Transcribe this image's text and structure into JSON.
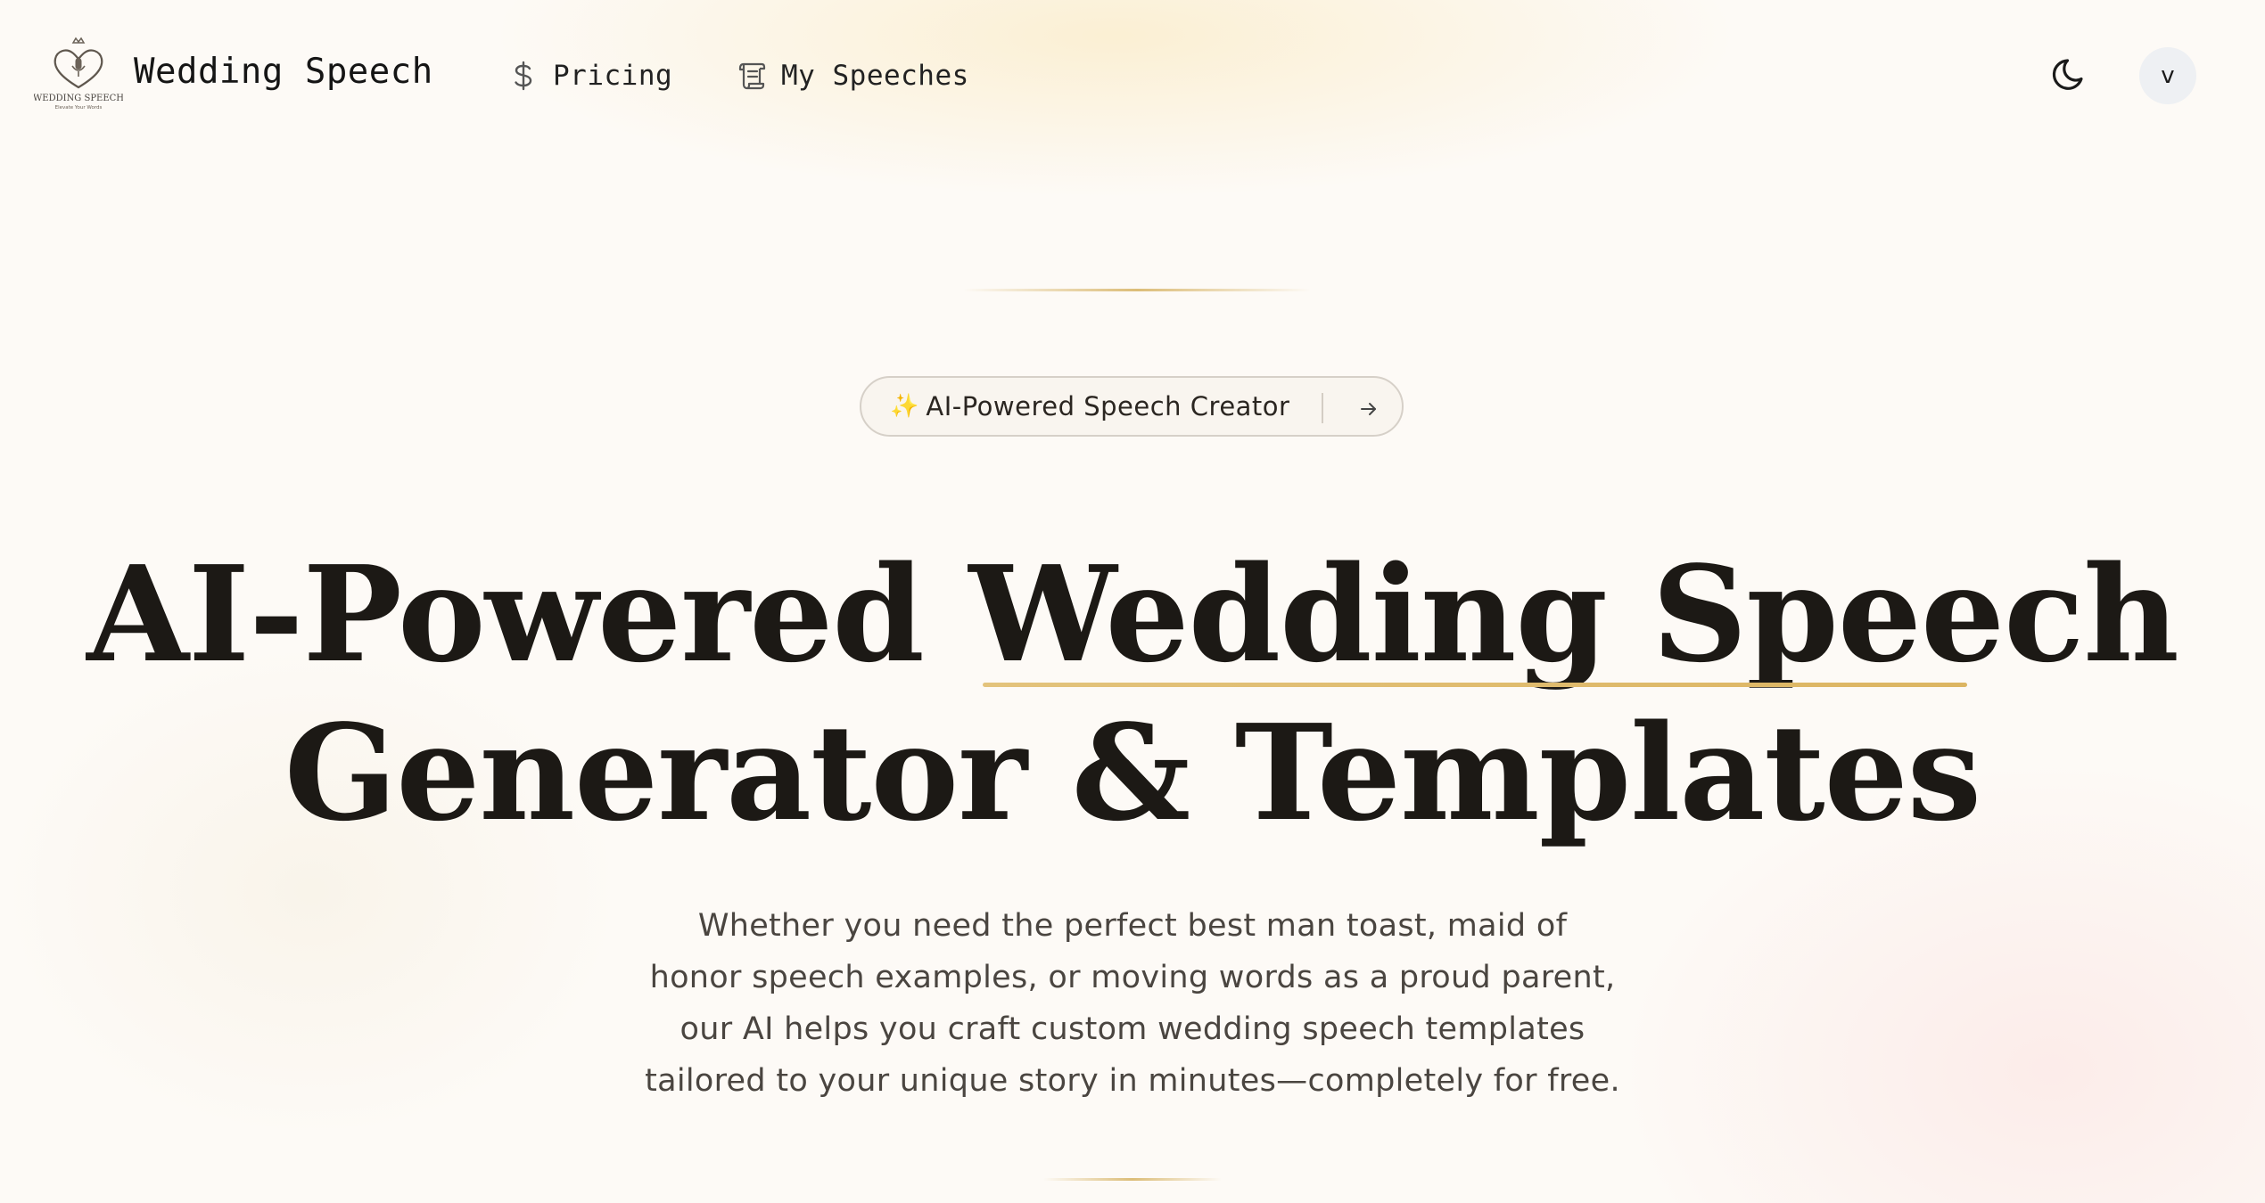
{
  "nav": {
    "brand": "Wedding Speech",
    "logo_text": "WEDDING SPEECH",
    "logo_tagline": "Elevate Your Words",
    "links": [
      {
        "label": "Pricing",
        "icon": "dollar-icon"
      },
      {
        "label": "My Speeches",
        "icon": "scroll-icon"
      }
    ],
    "theme_icon": "moon-icon",
    "avatar_initial": "v"
  },
  "badge": {
    "sparkle": "✨",
    "label": "AI-Powered Speech Creator",
    "icon": "arrow-right-icon"
  },
  "hero": {
    "title_line1": "AI-Powered Wedding Speech",
    "title_line2": "Generator & Templates",
    "subtitle_lines": [
      "Whether you need the perfect best man toast, maid of",
      "honor speech examples, or moving words as a proud parent,",
      "our AI helps you craft custom wedding speech templates",
      "tailored to your unique story in minutes—completely for free."
    ]
  },
  "colors": {
    "background": "#fdfaf6",
    "accent_gold": "#dcb562",
    "text_dark": "#1c1915",
    "text_muted": "#4a4540",
    "avatar_bg": "#eef0f3"
  }
}
